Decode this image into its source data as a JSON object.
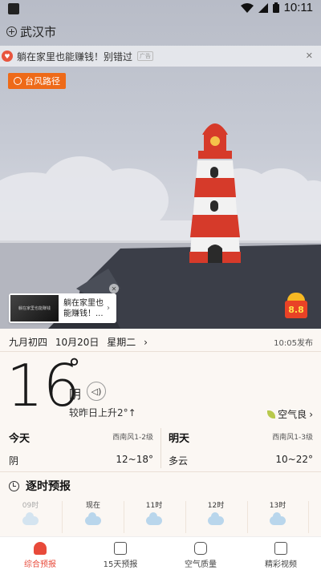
{
  "status": {
    "time": "10:11"
  },
  "header": {
    "city": "武汉市"
  },
  "ad_bar": {
    "text": "躺在家里也能赚钱！别错过",
    "tag": "广告",
    "close": "✕"
  },
  "typhoon": {
    "label": "台风路径"
  },
  "ad_card": {
    "thumb_text": "躺在家里也能赚钱",
    "text": "躺在家里也能赚钱！...",
    "close": "✕",
    "arrow": "›"
  },
  "gift": {
    "value": "8.8"
  },
  "date": {
    "lunar": "九月初四",
    "solar": "10月20日",
    "weekday": "星期二",
    "arrow": "›",
    "published": "10:05发布"
  },
  "current": {
    "temperature": "16",
    "degree": "°",
    "condition": "阴",
    "compare": "较昨日上升2°↑",
    "air_quality": "空气良",
    "air_arrow": "›",
    "speaker_icon": "speaker-icon"
  },
  "today": {
    "title": "今天",
    "wind": "西南风1-2级",
    "condition": "阴",
    "range": "12~18°"
  },
  "tomorrow": {
    "title": "明天",
    "wind": "西南风1-3级",
    "condition": "多云",
    "range": "10~22°"
  },
  "hourly": {
    "title": "逐时预报",
    "hours": [
      {
        "label": "09时",
        "icon": "cloud-icon"
      },
      {
        "label": "现在",
        "icon": "cloud-icon"
      },
      {
        "label": "11时",
        "icon": "cloud-icon"
      },
      {
        "label": "12时",
        "icon": "cloud-icon"
      },
      {
        "label": "13时",
        "icon": "cloud-icon"
      }
    ]
  },
  "nav": {
    "items": [
      {
        "label": "综合预报",
        "active": true
      },
      {
        "label": "15天预报"
      },
      {
        "label": "空气质量"
      },
      {
        "label": "精彩视频"
      }
    ]
  },
  "colors": {
    "accent": "#e84a3a",
    "typhoon": "#ee6a18",
    "gift": "#e94226"
  }
}
